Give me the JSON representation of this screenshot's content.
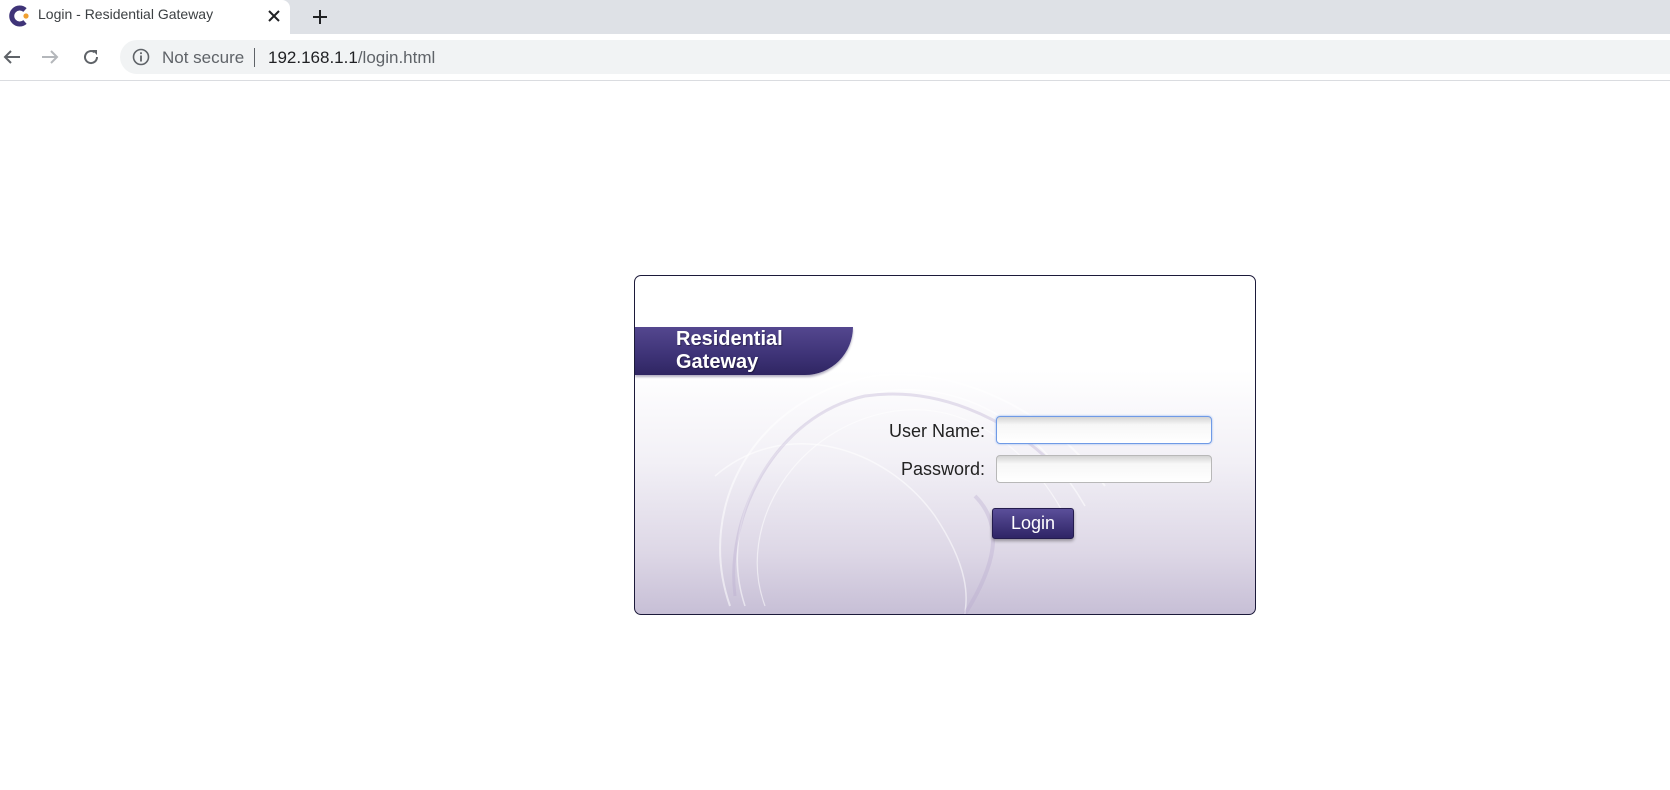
{
  "browser": {
    "tab_title": "Login - Residential Gateway",
    "security_text": "Not secure",
    "url_host": "192.168.1.1",
    "url_path": "/login.html"
  },
  "login": {
    "brand_title": "Residential Gateway",
    "username_label": "User Name:",
    "username_value": "",
    "password_label": "Password:",
    "password_value": "",
    "login_label": "Login"
  },
  "icons": {
    "favicon": "brand-c-logo-icon",
    "tab_close": "close-icon",
    "new_tab": "plus-icon",
    "back": "arrow-left-icon",
    "forward": "arrow-right-icon",
    "reload": "reload-icon",
    "info": "info-circle-icon"
  },
  "colors": {
    "brand_purple": "#3f3478",
    "tabstrip": "#dee1e6",
    "omnibox": "#f1f3f4",
    "focus_border": "#6f9ae6"
  }
}
